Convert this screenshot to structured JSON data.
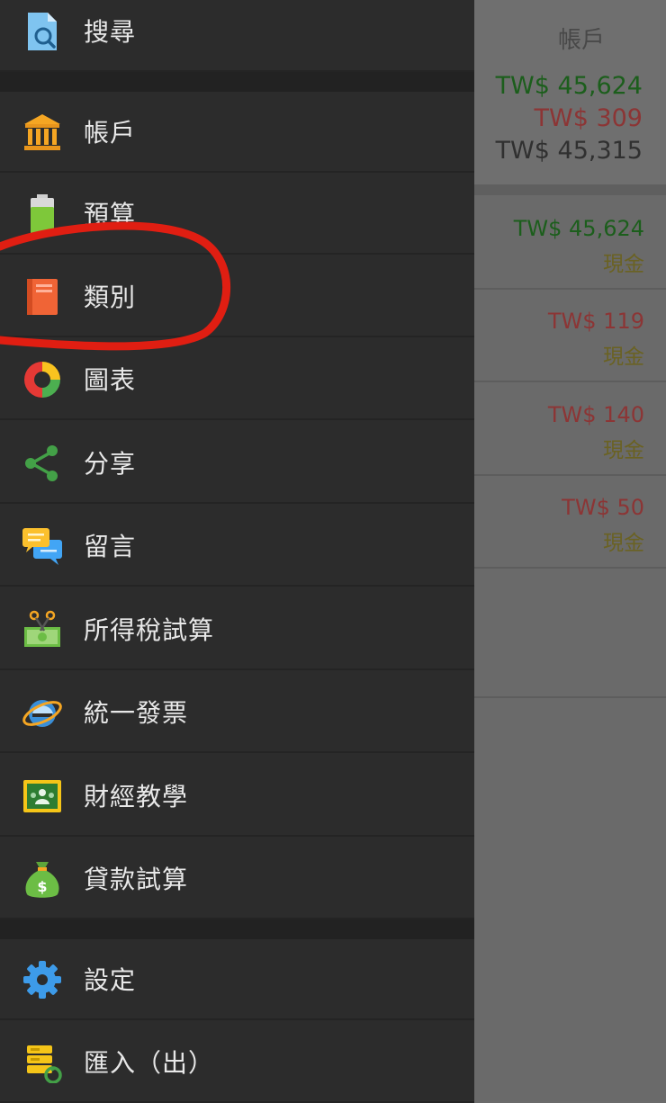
{
  "drawer": {
    "items": [
      {
        "label": "搜尋",
        "icon": "search-file-icon"
      },
      {
        "label": "帳戶",
        "icon": "bank-icon"
      },
      {
        "label": "預算",
        "icon": "battery-icon"
      },
      {
        "label": "類別",
        "icon": "book-icon"
      },
      {
        "label": "圖表",
        "icon": "donut-chart-icon"
      },
      {
        "label": "分享",
        "icon": "share-icon"
      },
      {
        "label": "留言",
        "icon": "chat-bubbles-icon"
      },
      {
        "label": "所得稅試算",
        "icon": "money-scissors-icon"
      },
      {
        "label": "統一發票",
        "icon": "ie-globe-icon"
      },
      {
        "label": "財經教學",
        "icon": "classroom-board-icon"
      },
      {
        "label": "貸款試算",
        "icon": "money-bag-icon"
      },
      {
        "label": "設定",
        "icon": "gear-icon"
      },
      {
        "label": "匯入（出）",
        "icon": "database-import-icon"
      }
    ]
  },
  "background": {
    "summary": {
      "title": "帳戶",
      "income": "TW$ 45,624",
      "expense": "TW$ 309",
      "balance": "TW$ 45,315"
    },
    "transactions": [
      {
        "amount": "TW$ 45,624",
        "account": "現金",
        "type": "income"
      },
      {
        "amount": "TW$ 119",
        "account": "現金",
        "type": "expense"
      },
      {
        "amount": "TW$ 140",
        "account": "現金",
        "type": "expense"
      },
      {
        "amount": "TW$ 50",
        "account": "現金",
        "type": "expense"
      }
    ]
  },
  "colors": {
    "drawer_bg": "#2c2c2c",
    "overlay_bg": "#6a6a6a",
    "income": "#1c5e1c",
    "expense": "#8c3535",
    "highlight": "#e01e12"
  }
}
